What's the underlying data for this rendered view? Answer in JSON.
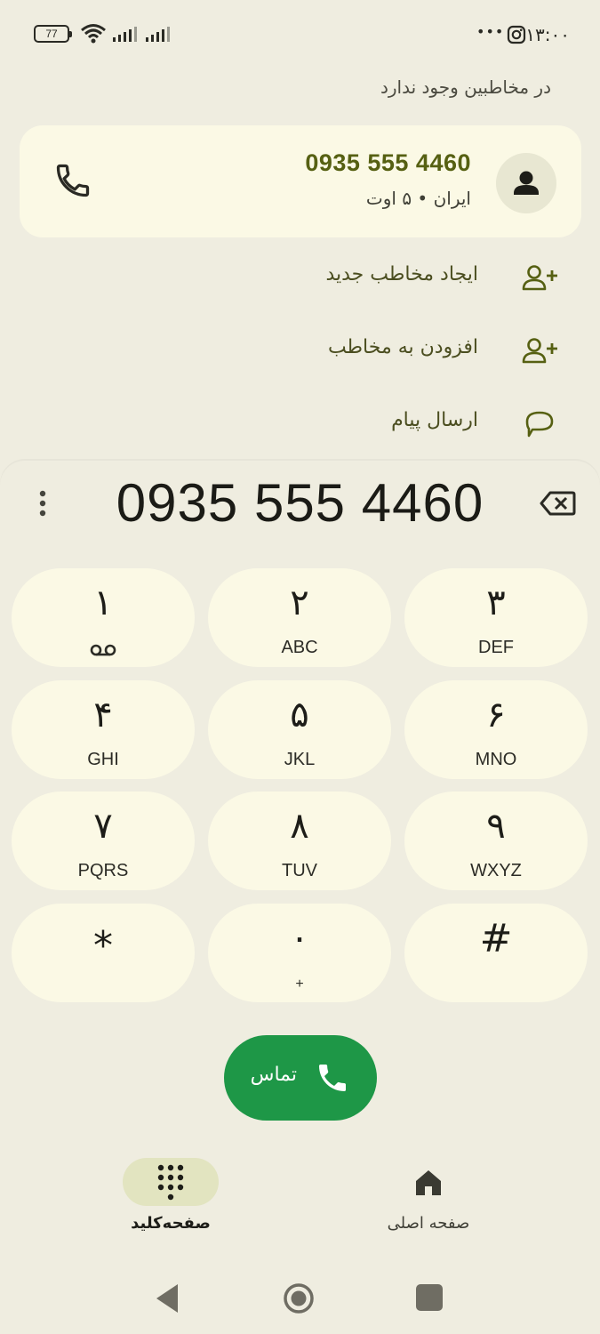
{
  "status_bar": {
    "battery": "77",
    "time": "۱۳:۰۰",
    "more": "•••"
  },
  "search_result": {
    "not_in_contacts": "در مخاطبین وجود ندارد",
    "number": "0935 555 4460",
    "subtitle": "ایران • ۵ اوت"
  },
  "actions": [
    {
      "label": "ایجاد مخاطب جدید",
      "icon": "person-add-icon"
    },
    {
      "label": "افزودن به مخاطب",
      "icon": "person-add-icon"
    },
    {
      "label": "ارسال پیام",
      "icon": "message-icon"
    }
  ],
  "dialer": {
    "number": "0935 555 4460",
    "keys": [
      {
        "digit": "۱",
        "letters": ""
      },
      {
        "digit": "۲",
        "letters": "ABC"
      },
      {
        "digit": "۳",
        "letters": "DEF"
      },
      {
        "digit": "۴",
        "letters": "GHI"
      },
      {
        "digit": "۵",
        "letters": "JKL"
      },
      {
        "digit": "۶",
        "letters": "MNO"
      },
      {
        "digit": "۷",
        "letters": "PQRS"
      },
      {
        "digit": "۸",
        "letters": "TUV"
      },
      {
        "digit": "۹",
        "letters": "WXYZ"
      },
      {
        "digit": "*",
        "letters": ""
      },
      {
        "digit": "۰",
        "letters": "+"
      },
      {
        "digit": "#",
        "letters": ""
      }
    ],
    "call_label": "تماس"
  },
  "bottom_nav": {
    "keypad_label": "صفحه‌کلید",
    "home_label": "صفحه اصلی"
  },
  "colors": {
    "background": "#efede0",
    "card": "#fbf9e5",
    "accent_olive": "#566012",
    "call_green": "#1e9747",
    "nav_pill": "#e2e4c0"
  }
}
